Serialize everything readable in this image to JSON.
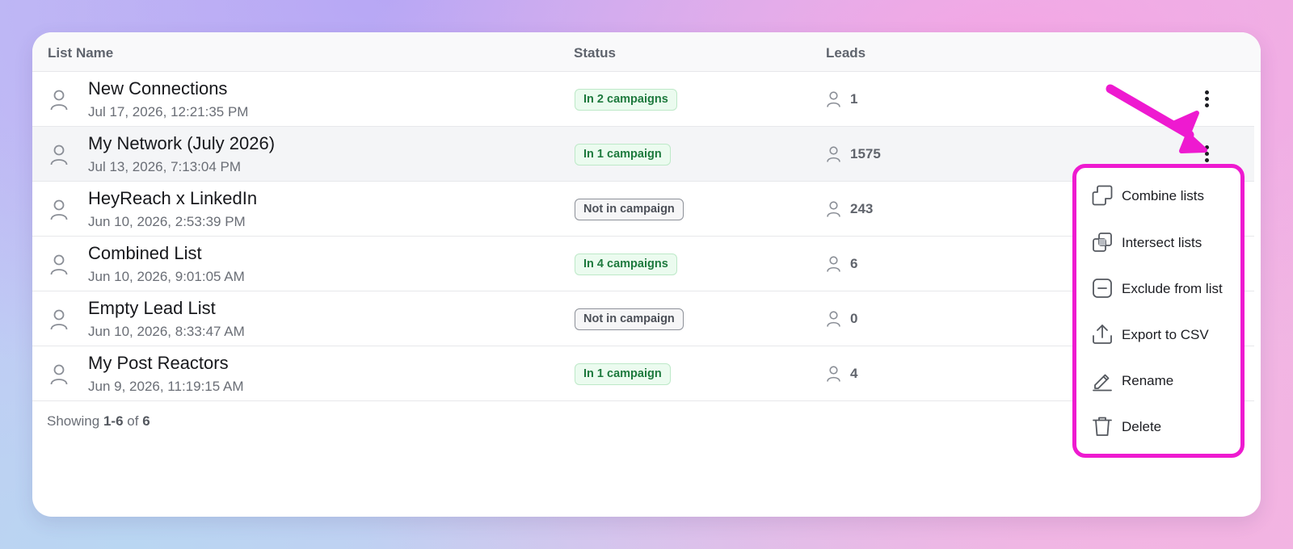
{
  "table": {
    "columns": {
      "name": "List Name",
      "status": "Status",
      "leads": "Leads"
    },
    "rows": [
      {
        "name": "New Connections",
        "date": "Jul 17, 2026, 12:21:35 PM",
        "status": "In 2 campaigns",
        "status_type": "green",
        "leads": "1"
      },
      {
        "name": "My Network (July 2026)",
        "date": "Jul 13, 2026, 7:13:04 PM",
        "status": "In 1 campaign",
        "status_type": "green",
        "leads": "1575"
      },
      {
        "name": "HeyReach x LinkedIn",
        "date": "Jun 10, 2026, 2:53:39 PM",
        "status": "Not in campaign",
        "status_type": "gray",
        "leads": "243"
      },
      {
        "name": "Combined List",
        "date": "Jun 10, 2026, 9:01:05 AM",
        "status": "In 4 campaigns",
        "status_type": "green",
        "leads": "6"
      },
      {
        "name": "Empty Lead List",
        "date": "Jun 10, 2026, 8:33:47 AM",
        "status": "Not in campaign",
        "status_type": "gray",
        "leads": "0"
      },
      {
        "name": "My Post Reactors",
        "date": "Jun 9, 2026, 11:19:15 AM",
        "status": "In 1 campaign",
        "status_type": "green",
        "leads": "4"
      }
    ]
  },
  "footer": {
    "prefix": "Showing",
    "range": "1-6",
    "of": "of",
    "total": "6"
  },
  "menu": {
    "items": [
      {
        "label": "Combine lists",
        "icon": "combine-icon"
      },
      {
        "label": "Intersect lists",
        "icon": "intersect-icon"
      },
      {
        "label": "Exclude from list",
        "icon": "exclude-icon"
      },
      {
        "label": "Export to CSV",
        "icon": "export-icon"
      },
      {
        "label": "Rename",
        "icon": "pencil-icon"
      },
      {
        "label": "Delete",
        "icon": "trash-icon"
      }
    ]
  },
  "colors": {
    "highlight": "#ee1ad0",
    "badge_green": "#1e7a3e",
    "badge_gray": "#4c5058"
  }
}
